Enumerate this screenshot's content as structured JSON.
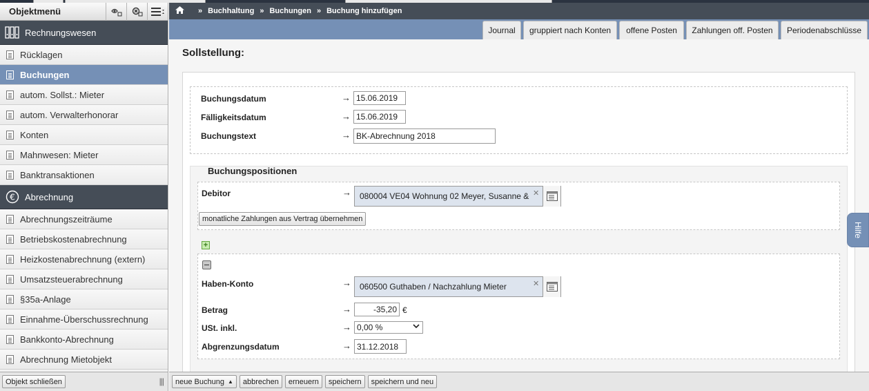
{
  "sidebar": {
    "header_title": "Objektmenü",
    "sections": [
      {
        "label": "Rechnungswesen",
        "icon": "binders-icon",
        "items": [
          {
            "label": "Rücklagen",
            "active": false
          },
          {
            "label": "Buchungen",
            "active": true
          },
          {
            "label": "autom. Sollst.: Mieter",
            "active": false
          },
          {
            "label": "autom. Verwalterhonorar",
            "active": false
          },
          {
            "label": "Konten",
            "active": false
          },
          {
            "label": "Mahnwesen: Mieter",
            "active": false
          },
          {
            "label": "Banktransaktionen",
            "active": false
          }
        ]
      },
      {
        "label": "Abrechnung",
        "icon": "euro-icon",
        "items": [
          {
            "label": "Abrechnungszeiträume",
            "active": false
          },
          {
            "label": "Betriebskostenabrechnung",
            "active": false
          },
          {
            "label": "Heizkostenabrechnung (extern)",
            "active": false
          },
          {
            "label": "Umsatzsteuerabrechnung",
            "active": false
          },
          {
            "label": "§35a-Anlage",
            "active": false
          },
          {
            "label": "Einnahme-Überschussrechnung",
            "active": false
          },
          {
            "label": "Bankkonto-Abrechnung",
            "active": false
          },
          {
            "label": "Abrechnung Mietobjekt",
            "active": false
          }
        ]
      }
    ],
    "footer_button": "Objekt schließen"
  },
  "breadcrumb": [
    "Buchhaltung",
    "Buchungen",
    "Buchung hinzufügen"
  ],
  "tabs": [
    "Journal",
    "gruppiert nach Konten",
    "offene Posten",
    "Zahlungen off. Posten",
    "Periodenabschlüsse"
  ],
  "page_title": "Sollstellung:",
  "form": {
    "buchungsdatum_label": "Buchungsdatum",
    "buchungsdatum_value": "15.06.2019",
    "faelligkeitsdatum_label": "Fälligkeitsdatum",
    "faelligkeitsdatum_value": "15.06.2019",
    "buchungstext_label": "Buchungstext",
    "buchungstext_value": "BK-Abrechnung 2018",
    "positions_title": "Buchungspositionen",
    "debitor_label": "Debitor",
    "debitor_value": "080004 VE04 Wohnung 02 Meyer, Susanne &",
    "monthly_button": "monatliche Zahlungen aus Vertrag übernehmen",
    "haben_label": "Haben-Konto",
    "haben_value": "060500 Guthaben / Nachzahlung Mieter",
    "betrag_label": "Betrag",
    "betrag_value": "-35,20",
    "currency": "€",
    "ust_label": "USt. inkl.",
    "ust_value": "0,00 %",
    "abgrenzung_label": "Abgrenzungsdatum",
    "abgrenzung_value": "31.12.2018"
  },
  "footer": {
    "new_booking": "neue Buchung",
    "cancel": "abbrechen",
    "renew": "erneuern",
    "save": "speichern",
    "save_new": "speichern und neu"
  },
  "help_tab": "Hilfe",
  "colors": {
    "accent": "#7590b6",
    "header_dark": "#454d57"
  }
}
